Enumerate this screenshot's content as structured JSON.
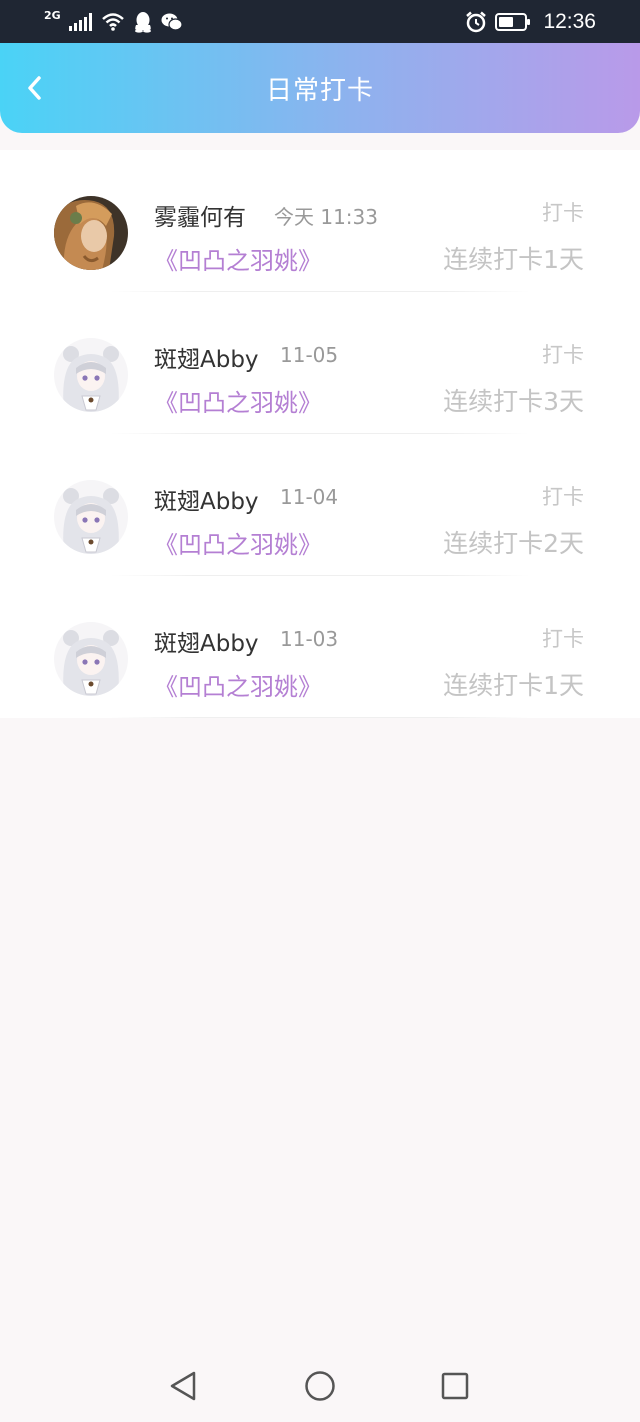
{
  "status_bar": {
    "network": "2G",
    "time": "12:36"
  },
  "header": {
    "title": "日常打卡",
    "gradient": [
      "#4ad3f6",
      "#b99ae9"
    ]
  },
  "list": [
    {
      "name": "雾霾何有",
      "time": "今天 11:33",
      "action": "打卡",
      "book": "《凹凸之羽姚》",
      "streak": "连续打卡1天",
      "avatar": "avatar-golden-hair"
    },
    {
      "name": "斑翅Abby",
      "time": "11-05",
      "action": "打卡",
      "book": "《凹凸之羽姚》",
      "streak": "连续打卡3天",
      "avatar": "avatar-white-hair"
    },
    {
      "name": "斑翅Abby",
      "time": "11-04",
      "action": "打卡",
      "book": "《凹凸之羽姚》",
      "streak": "连续打卡2天",
      "avatar": "avatar-white-hair"
    },
    {
      "name": "斑翅Abby",
      "time": "11-03",
      "action": "打卡",
      "book": "《凹凸之羽姚》",
      "streak": "连续打卡1天",
      "avatar": "avatar-white-hair"
    }
  ],
  "colors": {
    "book_title": "#b47fd3",
    "muted": "#999999"
  }
}
